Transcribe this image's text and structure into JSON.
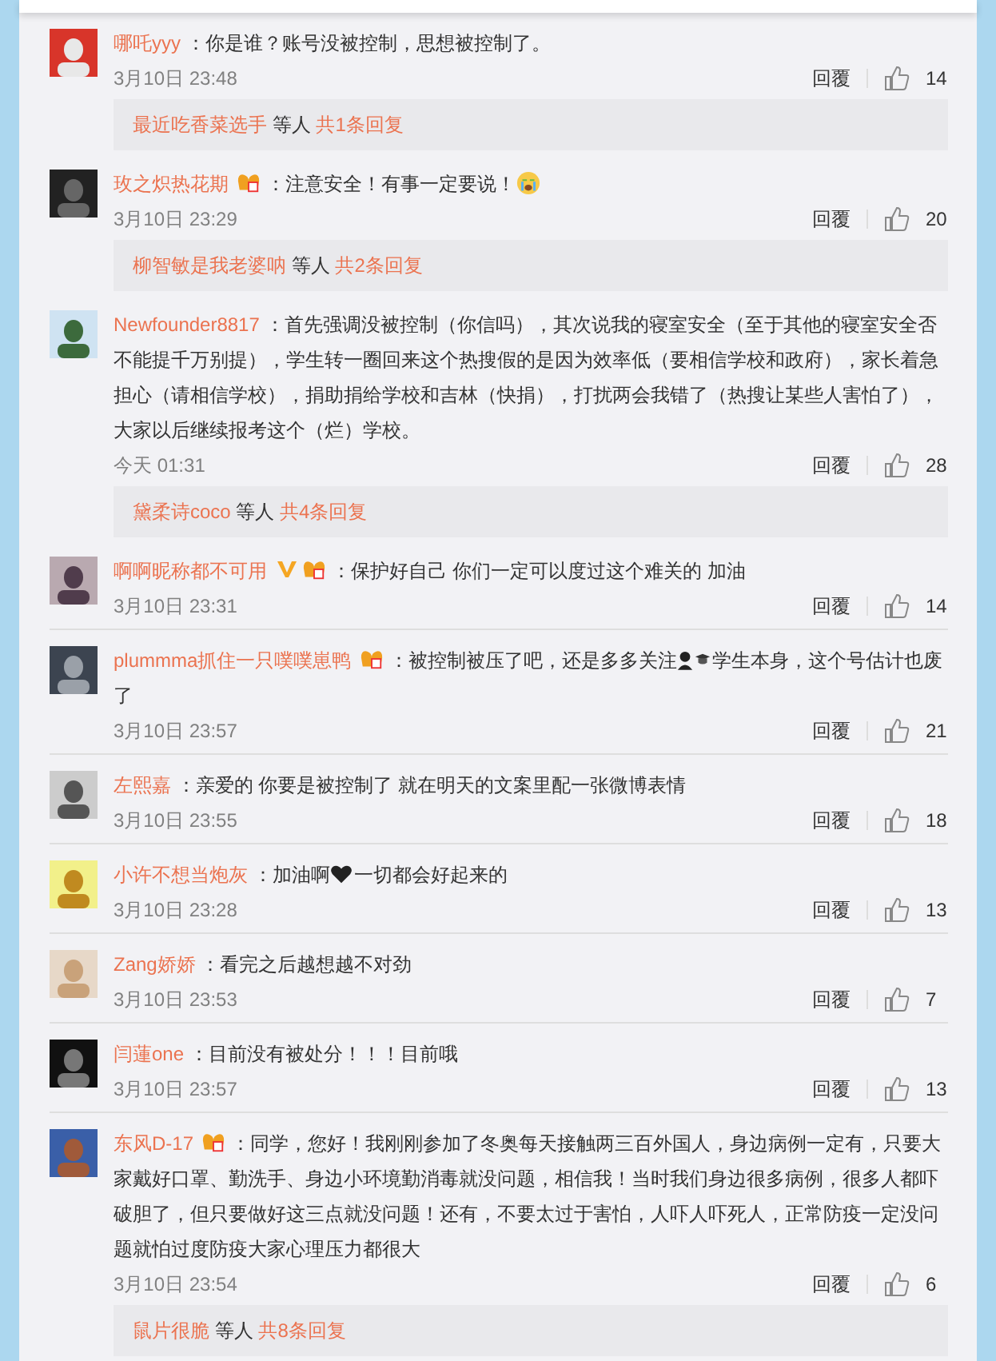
{
  "comments": [
    {
      "user": "哪吒yyy",
      "body": [
        {
          "kind": "text",
          "text": "：你是谁？账号没被控制，思想被控制了。"
        }
      ],
      "time": "3月10日 23:48",
      "reply_label": "回覆",
      "likes": "14",
      "replies": {
        "names": "最近吃香菜选手",
        "others": "等人",
        "count": "共1条回复"
      }
    },
    {
      "user": "玫之炽热花期",
      "badges": [
        {
          "kind": "member"
        }
      ],
      "body": [
        {
          "kind": "text",
          "text": "：注意安全！有事一定要说！"
        },
        {
          "kind": "crying-face"
        }
      ],
      "time": "3月10日 23:29",
      "reply_label": "回覆",
      "likes": "20",
      "replies": {
        "names": "柳智敏是我老婆呐",
        "others": "等人",
        "count": "共2条回复"
      }
    },
    {
      "user": "Newfounder8817",
      "body": [
        {
          "kind": "text",
          "text": "：首先强调没被控制（你信吗），其次说我的寝室安全（至于其他的寝室安全否不能提千万别提），学生转一圈回来这个热搜假的是因为效率低（要相信学校和政府），家长着急担心（请相信学校），捐助捐给学校和吉林（快捐），打扰两会我错了（热搜让某些人害怕了），大家以后继续报考这个（烂）学校。"
        }
      ],
      "time": "今天 01:31",
      "reply_label": "回覆",
      "likes": "28",
      "replies": {
        "names": "黛柔诗coco",
        "others": "等人",
        "count": "共4条回复"
      }
    },
    {
      "user": "啊啊昵称都不可用",
      "badges": [
        {
          "kind": "verified"
        },
        {
          "kind": "member"
        }
      ],
      "body": [
        {
          "kind": "text",
          "text": "：保护好自己 你们一定可以度过这个难关的 加油"
        }
      ],
      "time": "3月10日 23:31",
      "reply_label": "回覆",
      "likes": "14"
    },
    {
      "user": "plummma抓住一只噗噗崽鸭",
      "badges": [
        {
          "kind": "member"
        }
      ],
      "body": [
        {
          "kind": "text",
          "text": "：被控制被压了吧，还是多多关注"
        },
        {
          "kind": "student"
        },
        {
          "kind": "text",
          "text": "学生本身，这个号估计也废了"
        }
      ],
      "time": "3月10日 23:57",
      "reply_label": "回覆",
      "likes": "21"
    },
    {
      "user": "左熙嘉",
      "body": [
        {
          "kind": "text",
          "text": "：亲爱的 你要是被控制了 就在明天的文案里配一张微博表情"
        }
      ],
      "time": "3月10日 23:55",
      "reply_label": "回覆",
      "likes": "18"
    },
    {
      "user": "小许不想当炮灰",
      "body": [
        {
          "kind": "text",
          "text": "：加油啊"
        },
        {
          "kind": "heart"
        },
        {
          "kind": "text",
          "text": "一切都会好起来的"
        }
      ],
      "time": "3月10日 23:28",
      "reply_label": "回覆",
      "likes": "13"
    },
    {
      "user": "Zang娇娇",
      "body": [
        {
          "kind": "text",
          "text": "：看完之后越想越不对劲"
        }
      ],
      "time": "3月10日 23:53",
      "reply_label": "回覆",
      "likes": "7"
    },
    {
      "user": "闫蓮one",
      "body": [
        {
          "kind": "text",
          "text": "：目前没有被处分！！！目前哦"
        }
      ],
      "time": "3月10日 23:57",
      "reply_label": "回覆",
      "likes": "13"
    },
    {
      "user": "东风D-17",
      "badges": [
        {
          "kind": "member"
        }
      ],
      "body": [
        {
          "kind": "text",
          "text": "：同学，您好！我刚刚参加了冬奥每天接触两三百外国人，身边病例一定有，只要大家戴好口罩、勤洗手、身边小环境勤消毒就没问题，相信我！当时我们身边很多病例，很多人都吓破胆了，但只要做好这三点就没问题！还有，不要太过于害怕，人吓人吓死人，正常防疫一定没问题就怕过度防疫大家心理压力都很大"
        }
      ],
      "time": "3月10日 23:54",
      "reply_label": "回覆",
      "likes": "6",
      "replies": {
        "names": "鼠片很脆",
        "others": "等人",
        "count": "共8条回复"
      }
    }
  ]
}
